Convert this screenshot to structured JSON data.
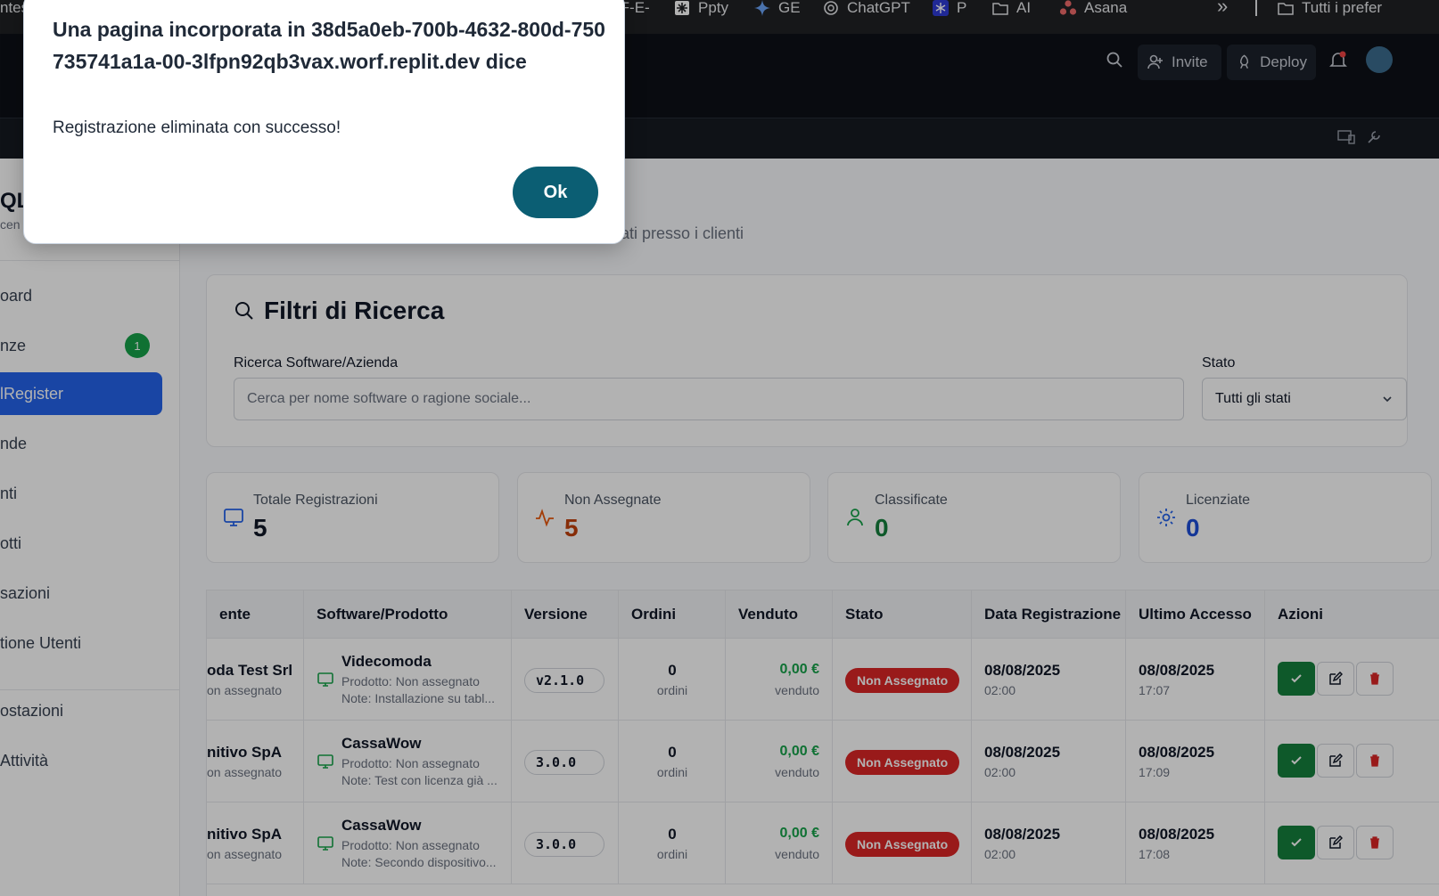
{
  "bookmarks": [
    {
      "label": "ntes"
    },
    {
      "label": "-F-E-"
    },
    {
      "label": "Ppty"
    },
    {
      "label": "GE"
    },
    {
      "label": "ChatGPT"
    },
    {
      "label": "P"
    },
    {
      "label": "AI"
    },
    {
      "label": "Asana"
    },
    {
      "label": "»"
    },
    {
      "label": "Tutti i prefer"
    }
  ],
  "replit": {
    "invite_label": "Invite",
    "deploy_label": "Deploy"
  },
  "sidebar": {
    "brand": "QLM",
    "brand_sub": "cen",
    "items": [
      {
        "label": "oard"
      },
      {
        "label": "nze",
        "badge": "1"
      },
      {
        "label": "lRegister"
      },
      {
        "label": "nde"
      },
      {
        "label": "nti"
      },
      {
        "label": "otti"
      },
      {
        "label": "sazioni"
      },
      {
        "label": "tione Utenti"
      },
      {
        "label": "ostazioni"
      },
      {
        "label": "Attività"
      }
    ]
  },
  "page": {
    "subtitle": "ati presso i clienti"
  },
  "filters": {
    "title": "Filtri di Ricerca",
    "search_label": "Ricerca Software/Azienda",
    "search_placeholder": "Cerca per nome software o ragione sociale...",
    "state_label": "Stato",
    "state_value": "Tutti gli stati"
  },
  "stats": [
    {
      "label": "Totale Registrazioni",
      "value": "5",
      "color": "#111827",
      "icon": "monitor-icon",
      "icon_color": "#2563eb"
    },
    {
      "label": "Non Assegnate",
      "value": "5",
      "color": "#c2410c",
      "icon": "activity-icon",
      "icon_color": "#ea580c"
    },
    {
      "label": "Classificate",
      "value": "0",
      "color": "#15803d",
      "icon": "user-icon",
      "icon_color": "#16a34a"
    },
    {
      "label": "Licenziate",
      "value": "0",
      "color": "#1d4ed8",
      "icon": "gear-icon",
      "icon_color": "#2563eb"
    }
  ],
  "table": {
    "headers": [
      "ente",
      "Software/Prodotto",
      "Versione",
      "Ordini",
      "Venduto",
      "Stato",
      "Data Registrazione",
      "Ultimo Accesso",
      "Azioni"
    ],
    "rows": [
      {
        "client": "oda Test Srl",
        "client_sub": "on assegnato",
        "software": "Videcomoda",
        "product": "Prodotto: Non assegnato",
        "note": "Note: Installazione su tabl...",
        "version": "v2.1.0",
        "orders": "0",
        "orders_unit": "ordini",
        "sold": "0,00 €",
        "sold_unit": "venduto",
        "status": "Non Assegnato",
        "reg_date": "08/08/2025",
        "reg_time": "02:00",
        "last_date": "08/08/2025",
        "last_time": "17:07"
      },
      {
        "client": "nitivo SpA",
        "client_sub": "on assegnato",
        "software": "CassaWow",
        "product": "Prodotto: Non assegnato",
        "note": "Note: Test con licenza già ...",
        "version": "3.0.0",
        "orders": "0",
        "orders_unit": "ordini",
        "sold": "0,00 €",
        "sold_unit": "venduto",
        "status": "Non Assegnato",
        "reg_date": "08/08/2025",
        "reg_time": "02:00",
        "last_date": "08/08/2025",
        "last_time": "17:09"
      },
      {
        "client": "nitivo SpA",
        "client_sub": "on assegnato",
        "software": "CassaWow",
        "product": "Prodotto: Non assegnato",
        "note": "Note: Secondo dispositivo...",
        "version": "3.0.0",
        "orders": "0",
        "orders_unit": "ordini",
        "sold": "0,00 €",
        "sold_unit": "venduto",
        "status": "Non Assegnato",
        "reg_date": "08/08/2025",
        "reg_time": "02:00",
        "last_date": "08/08/2025",
        "last_time": "17:08"
      }
    ]
  },
  "dialog": {
    "title": "Una pagina incorporata in 38d5a0eb-700b-4632-800d-750735741a1a-00-3lfpn92qb3vax.worf.replit.dev dice",
    "message": "Registrazione eliminata con successo!",
    "ok_label": "Ok"
  }
}
